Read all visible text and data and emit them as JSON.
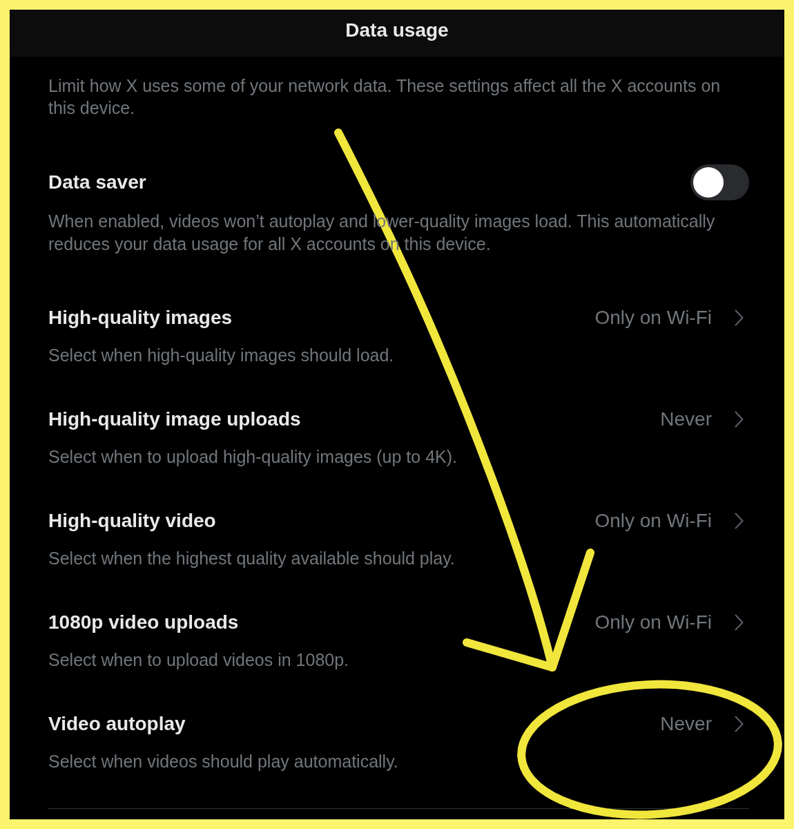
{
  "header": {
    "title": "Data usage"
  },
  "intro": "Limit how X uses some of your network data. These settings affect all the X accounts on this device.",
  "data_saver": {
    "title": "Data saver",
    "on": false,
    "description": "When enabled, videos won’t autoplay and lower-quality images load. This automatically reduces your data usage for all X accounts on this device."
  },
  "settings": [
    {
      "title": "High-quality images",
      "value": "Only on Wi-Fi",
      "description": "Select when high-quality images should load."
    },
    {
      "title": "High-quality image uploads",
      "value": "Never",
      "description": "Select when to upload high-quality images (up to 4K)."
    },
    {
      "title": "High-quality video",
      "value": "Only on Wi-Fi",
      "description": "Select when the highest quality available should play."
    },
    {
      "title": "1080p video uploads",
      "value": "Only on Wi-Fi",
      "description": "Select when to upload videos in 1080p."
    },
    {
      "title": "Video autoplay",
      "value": "Never",
      "description": "Select when videos should play automatically."
    }
  ],
  "annotations": [
    {
      "kind": "arrow"
    },
    {
      "kind": "circle"
    }
  ]
}
